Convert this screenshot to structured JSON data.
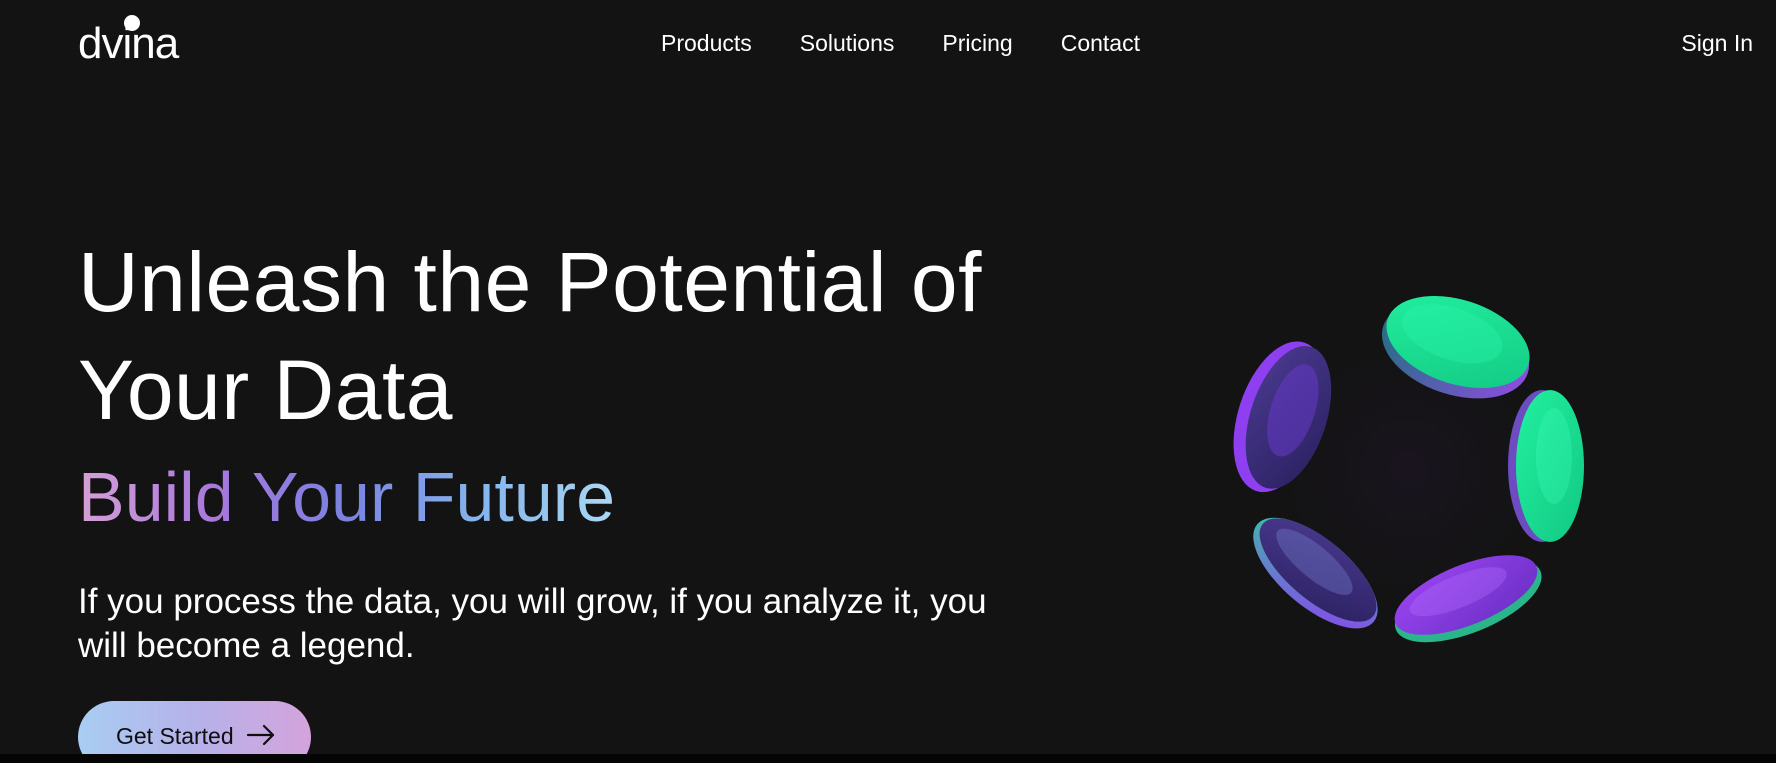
{
  "header": {
    "logo_text": "dvina",
    "nav": [
      {
        "label": "Products"
      },
      {
        "label": "Solutions"
      },
      {
        "label": "Pricing"
      },
      {
        "label": "Contact"
      }
    ],
    "sign_in_label": "Sign In"
  },
  "hero": {
    "headline": "Unleash the Potential of Your Data",
    "subheadline": "Build Your Future",
    "description": "If you process the data, you will grow, if you analyze it, you will become a legend.",
    "cta_label": "Get Started",
    "cta_icon": "arrow-right-icon"
  },
  "colors": {
    "background": "#131313",
    "accent_green": "#19e594",
    "accent_purple": "#8b3ef0",
    "gradient_pink": "#d5a0d6",
    "gradient_blue": "#a9d8f5"
  }
}
